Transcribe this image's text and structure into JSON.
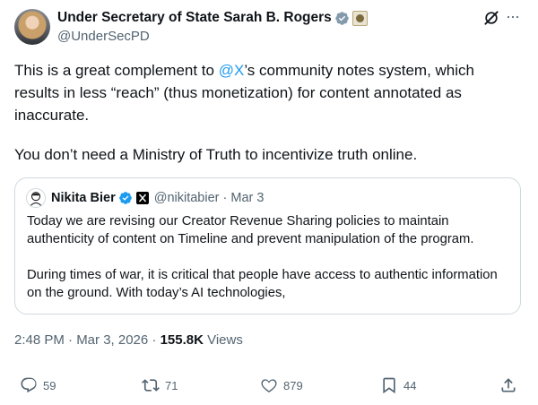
{
  "author": {
    "name": "Under Secretary of State Sarah B. Rogers",
    "handle": "@UnderSecPD"
  },
  "post": {
    "text_before_mention": "This is a great complement to ",
    "mention": "@X",
    "text_after_mention": "’s  community notes system, which results in less “reach” (thus monetization) for content annotated as inaccurate.",
    "paragraph2": "You don’t need a Ministry of Truth to incentivize truth online."
  },
  "quoted": {
    "name": "Nikita Bier",
    "handle_date": "@nikitabier · Mar 3",
    "paragraph1": "Today we are revising our Creator Revenue Sharing policies to maintain authenticity of content on Timeline and prevent manipulation of the program.",
    "paragraph2": "During times of war, it is critical that people have access to authentic information on the ground. With today’s AI technologies,"
  },
  "meta": {
    "time_date": "2:48 PM · Mar 3, 2026 · ",
    "views_count": "155.8K",
    "views_label": " Views"
  },
  "actions": {
    "replies": "59",
    "reposts": "71",
    "likes": "879",
    "bookmarks": "44"
  },
  "colors": {
    "accent": "#1d9bf0",
    "text": "#0f1419",
    "secondary": "#536471",
    "border": "#cfd9de"
  },
  "icons": [
    "verified-badge-icon",
    "government-seal-icon",
    "grok-icon",
    "more-icon",
    "x-logo-icon",
    "reply-icon",
    "repost-icon",
    "like-icon",
    "bookmark-icon",
    "share-icon"
  ]
}
